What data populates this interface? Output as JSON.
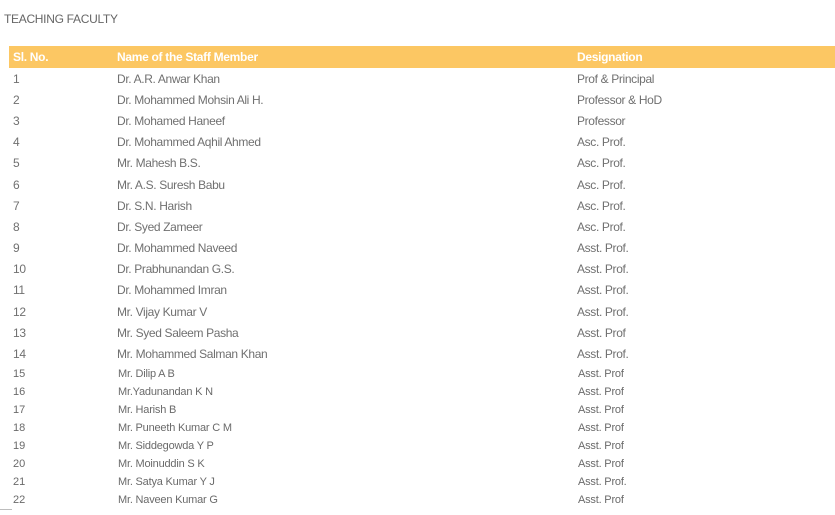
{
  "page": {
    "title": "TEACHING FACULTY"
  },
  "colors": {
    "header_bg": "#fcc763",
    "header_text": "#ffffff",
    "body_text": "#707070"
  },
  "table": {
    "headers": [
      "Sl. No.",
      "Name of the Staff Member",
      "Designation"
    ],
    "rows": [
      {
        "sl": "1",
        "name": "Dr. A.R. Anwar Khan",
        "designation": "Prof & Principal"
      },
      {
        "sl": "2",
        "name": "Dr. Mohammed Mohsin Ali H.",
        "designation": "Professor & HoD"
      },
      {
        "sl": "3",
        "name": "Dr. Mohamed Haneef",
        "designation": "Professor"
      },
      {
        "sl": "4",
        "name": "Dr. Mohammed Aqhil Ahmed",
        "designation": "Asc. Prof."
      },
      {
        "sl": "5",
        "name": "Mr. Mahesh B.S.",
        "designation": "Asc. Prof."
      },
      {
        "sl": "6",
        "name": "Mr. A.S. Suresh Babu",
        "designation": "Asc. Prof."
      },
      {
        "sl": "7",
        "name": "Dr. S.N. Harish",
        "designation": "Asc. Prof."
      },
      {
        "sl": "8",
        "name": "Dr. Syed Zameer",
        "designation": "Asc. Prof."
      },
      {
        "sl": "9",
        "name": "Dr. Mohammed Naveed",
        "designation": "Asst. Prof."
      },
      {
        "sl": "10",
        "name": "Dr. Prabhunandan G.S.",
        "designation": "Asst. Prof."
      },
      {
        "sl": "11",
        "name": "Dr. Mohammed Imran",
        "designation": "Asst. Prof."
      },
      {
        "sl": "12",
        "name": "Mr. Vijay Kumar V",
        "designation": "Asst. Prof."
      },
      {
        "sl": "13",
        "name": "Mr. Syed Saleem Pasha",
        "designation": "Asst. Prof"
      },
      {
        "sl": "14",
        "name": "Mr. Mohammed Salman Khan",
        "designation": "Asst. Prof."
      },
      {
        "sl": "15",
        "name": "Mr. Dilip A B",
        "designation": "Asst. Prof"
      },
      {
        "sl": "16",
        "name": "Mr.Yadunandan K N",
        "designation": "Asst. Prof"
      },
      {
        "sl": "17",
        "name": "Mr. Harish B",
        "designation": "Asst. Prof"
      },
      {
        "sl": "18",
        "name": "Mr. Puneeth Kumar C M",
        "designation": "Asst. Prof"
      },
      {
        "sl": "19",
        "name": "Mr. Siddegowda Y P",
        "designation": "Asst. Prof"
      },
      {
        "sl": "20",
        "name": "Mr. Moinuddin S K",
        "designation": "Asst. Prof"
      },
      {
        "sl": "21",
        "name": "Mr. Satya Kumar Y J",
        "designation": "Asst. Prof."
      },
      {
        "sl": "22",
        "name": "Mr. Naveen Kumar G",
        "designation": "Asst. Prof"
      }
    ]
  }
}
